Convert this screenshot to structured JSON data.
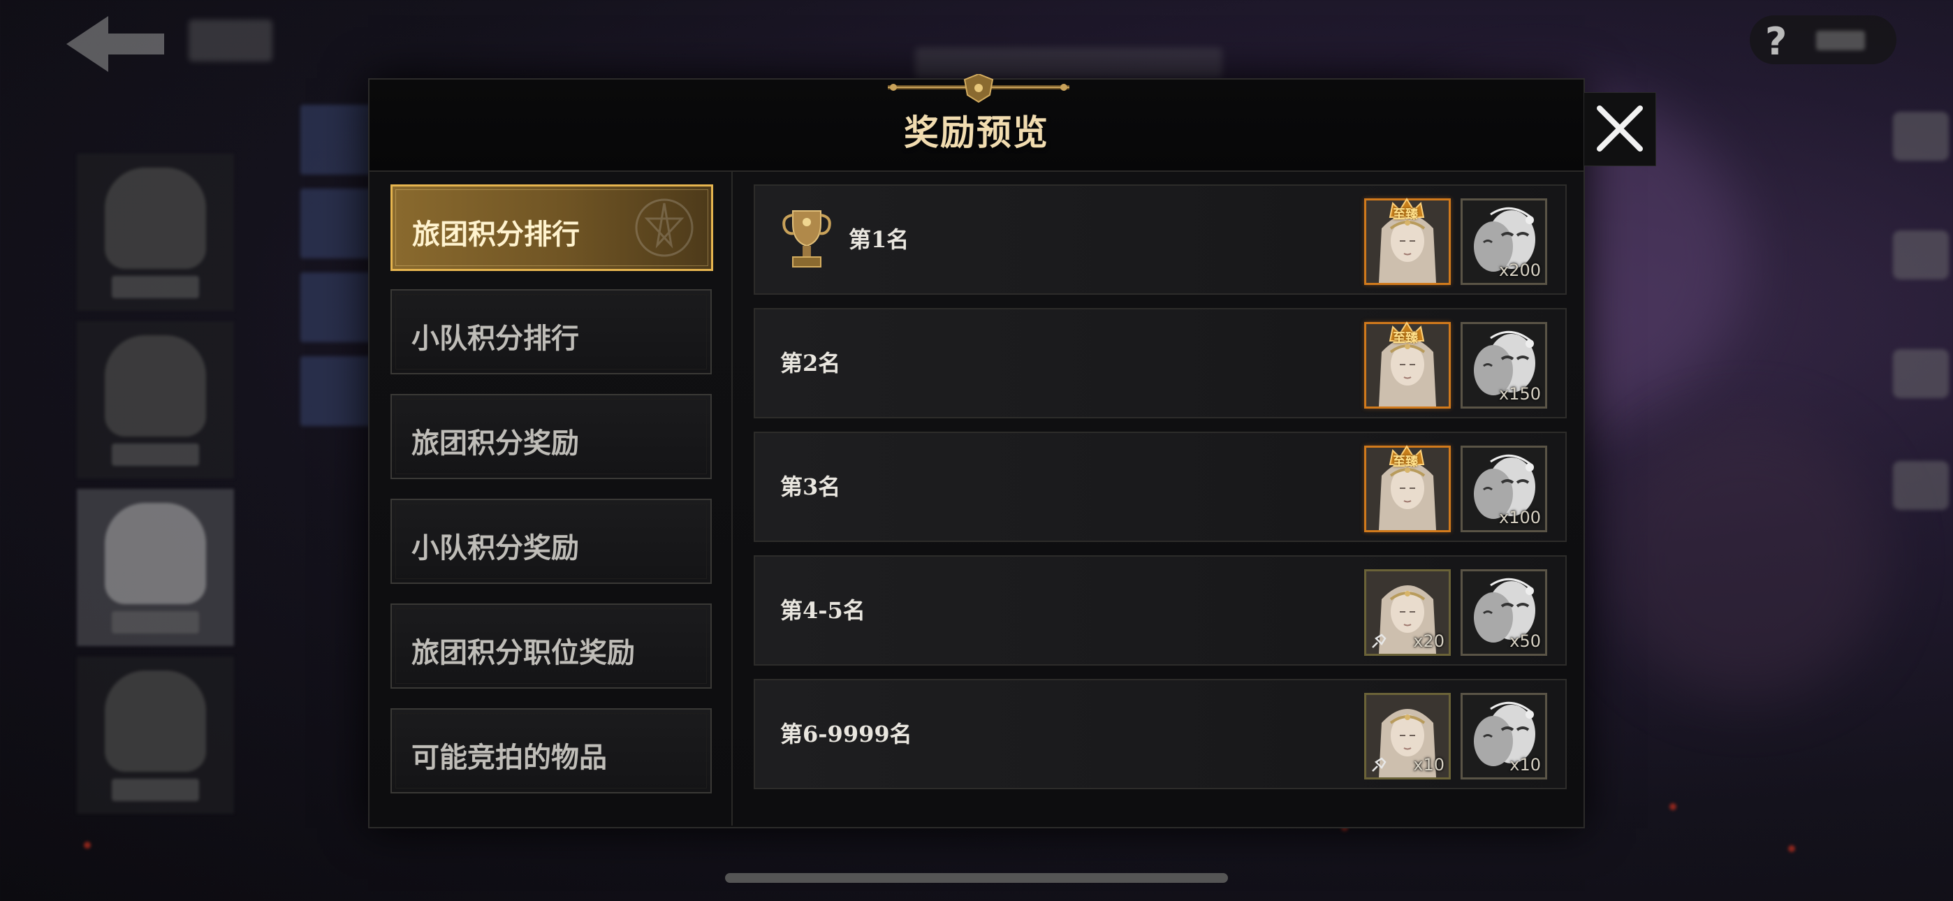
{
  "modal": {
    "title": "奖励预览"
  },
  "categories": [
    {
      "label": "旅团积分排行",
      "active": true
    },
    {
      "label": "小队积分排行",
      "active": false
    },
    {
      "label": "旅团积分奖励",
      "active": false
    },
    {
      "label": "小队积分奖励",
      "active": false
    },
    {
      "label": "旅团积分职位奖励",
      "active": false
    },
    {
      "label": "可能竞拍的物品",
      "active": false
    }
  ],
  "rewards": [
    {
      "rank": "第1名",
      "trophy": true,
      "items": [
        {
          "icon": "portrait-icon",
          "frame": "gold",
          "badge": "至臻",
          "qty": ""
        },
        {
          "icon": "mask-icon",
          "frame": "plain",
          "qty": "x200"
        }
      ]
    },
    {
      "rank": "第2名",
      "trophy": false,
      "items": [
        {
          "icon": "portrait-icon",
          "frame": "gold",
          "badge": "至臻",
          "qty": ""
        },
        {
          "icon": "mask-icon",
          "frame": "plain",
          "qty": "x150"
        }
      ]
    },
    {
      "rank": "第3名",
      "trophy": false,
      "items": [
        {
          "icon": "portrait-icon",
          "frame": "gold",
          "badge": "至臻",
          "qty": ""
        },
        {
          "icon": "mask-icon",
          "frame": "plain",
          "qty": "x100"
        }
      ]
    },
    {
      "rank": "第4-5名",
      "trophy": false,
      "items": [
        {
          "icon": "portrait-icon",
          "frame": "olive",
          "qty": "x20"
        },
        {
          "icon": "mask-icon",
          "frame": "plain",
          "qty": "x50"
        }
      ]
    },
    {
      "rank": "第6-9999名",
      "trophy": false,
      "items": [
        {
          "icon": "portrait-icon",
          "frame": "olive",
          "qty": "x10"
        },
        {
          "icon": "mask-icon",
          "frame": "plain",
          "qty": "x10"
        }
      ]
    }
  ],
  "help": {
    "icon": "question-icon"
  },
  "colors": {
    "accent_gold": "#e6b54f",
    "title_text": "#f1dcb0",
    "item_gold_frame": "#d17a1c"
  }
}
